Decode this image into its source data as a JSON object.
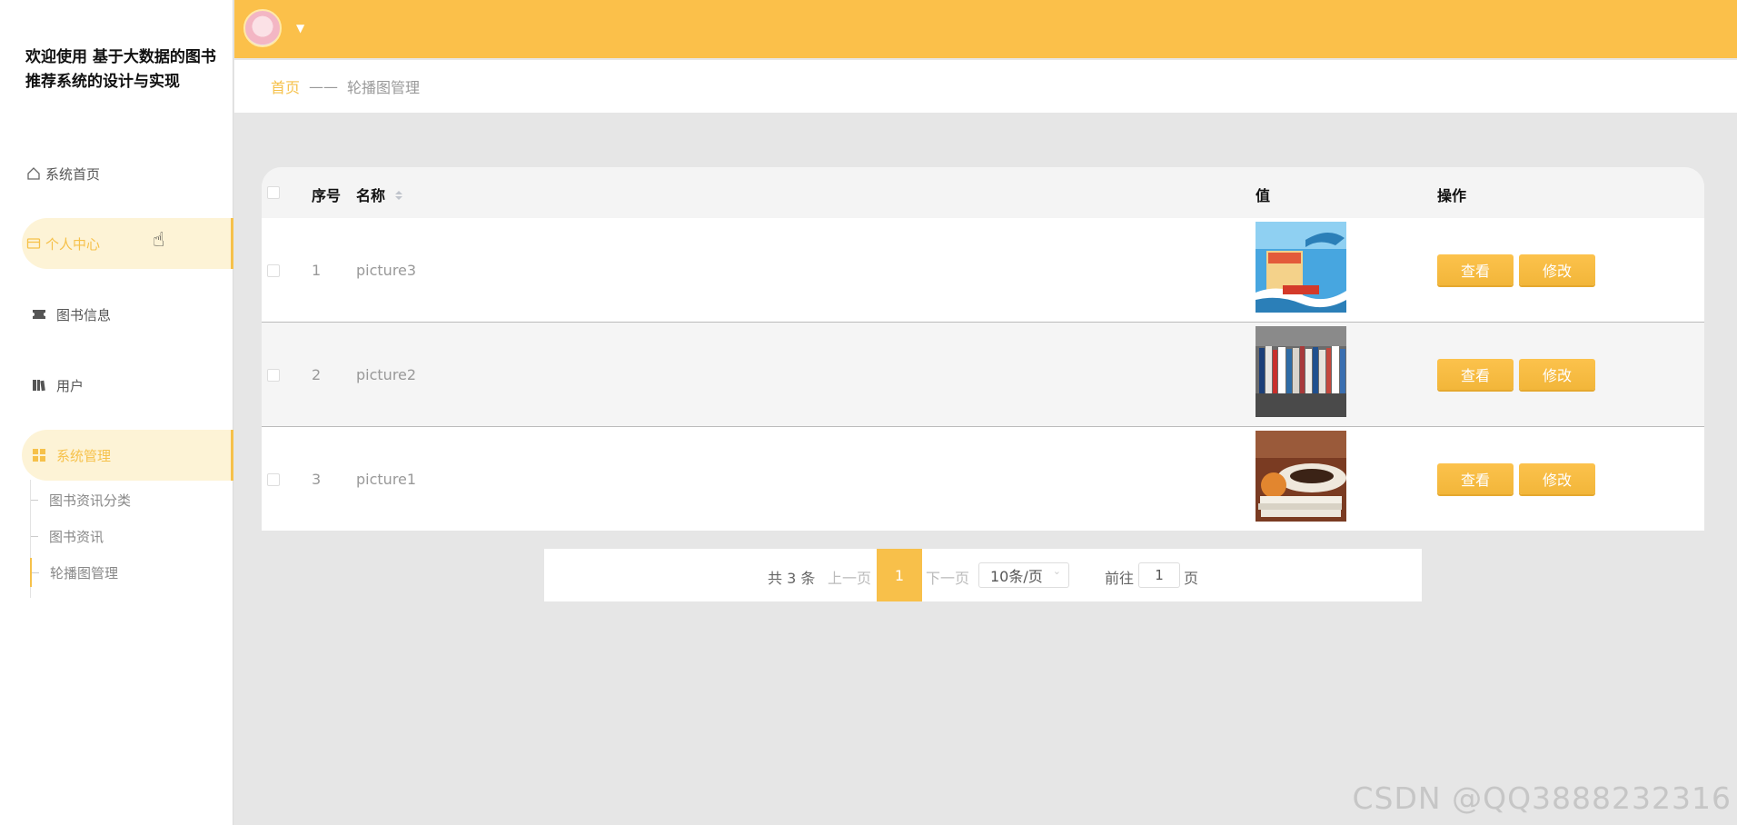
{
  "app": {
    "title": "欢迎使用 基于大数据的图书推荐系统的设计与实现"
  },
  "sidebar": {
    "items": [
      {
        "label": "系统首页",
        "icon": "home-icon"
      },
      {
        "label": "个人中心",
        "icon": "card-icon"
      },
      {
        "label": "图书信息",
        "icon": "ticket-icon"
      },
      {
        "label": "用户",
        "icon": "book-icon"
      },
      {
        "label": "系统管理",
        "icon": "grid-icon"
      }
    ],
    "sub_items": [
      {
        "label": "图书资讯分类"
      },
      {
        "label": "图书资讯"
      },
      {
        "label": "轮播图管理"
      }
    ]
  },
  "header": {
    "avatar_caret": "▼"
  },
  "breadcrumb": {
    "home": "首页",
    "separator": "——",
    "current": "轮播图管理"
  },
  "table": {
    "columns": {
      "index": "序号",
      "name": "名称",
      "value": "值",
      "actions": "操作"
    },
    "rows": [
      {
        "index": "1",
        "name": "picture3",
        "view": "查看",
        "edit": "修改"
      },
      {
        "index": "2",
        "name": "picture2",
        "view": "查看",
        "edit": "修改"
      },
      {
        "index": "3",
        "name": "picture1",
        "view": "查看",
        "edit": "修改"
      }
    ]
  },
  "pagination": {
    "total": "共 3 条",
    "prev": "上一页",
    "current_page": "1",
    "next": "下一页",
    "page_size": "10条/页",
    "goto_label": "前往",
    "goto_value": "1",
    "goto_unit": "页"
  },
  "watermark": "CSDN @QQ3888232316",
  "colors": {
    "accent": "#fbc04a",
    "active_bg": "#fdf3d6"
  }
}
